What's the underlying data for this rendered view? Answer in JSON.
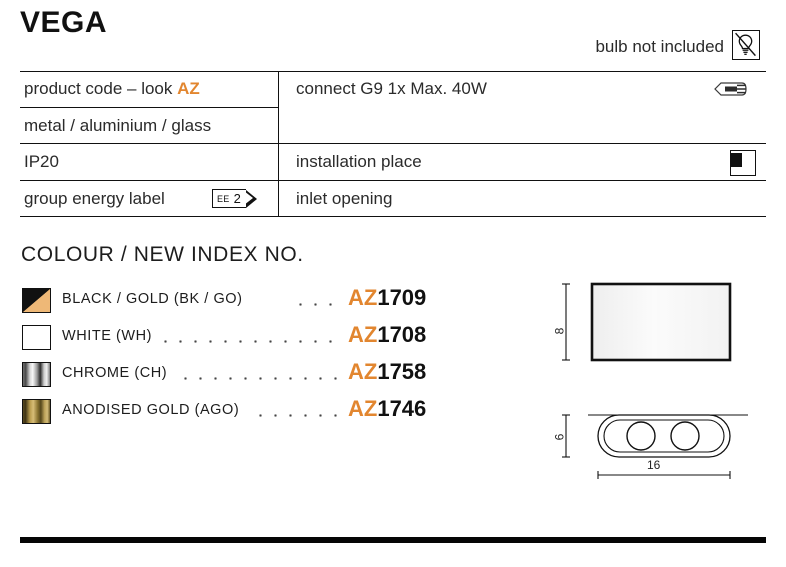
{
  "product": {
    "title": "VEGA",
    "bulb_note": "bulb not included",
    "bulb_icon": "bulb-not-included-icon"
  },
  "spec_table": {
    "left_column": [
      {
        "label": "product code – look ",
        "accent": "AZ",
        "name": "product-code"
      },
      {
        "label": "metal / aluminium / glass",
        "accent": "",
        "name": "materials"
      },
      {
        "label": "IP20",
        "accent": "",
        "name": "ip-rating"
      },
      {
        "label": "group energy label",
        "accent": "",
        "name": "energy-label"
      }
    ],
    "right_column": [
      {
        "label": "connect G9 1x Max. 40W",
        "name": "connection",
        "icon": "g9-bulb-icon"
      },
      {
        "label": "installation place",
        "name": "installation-place",
        "icon": "installation-place-icon"
      },
      {
        "label": "inlet opening",
        "name": "inlet-opening",
        "icon": ""
      }
    ],
    "energy_badge": {
      "text": "EE",
      "value": "2"
    }
  },
  "colour_section": {
    "heading": "COLOUR / NEW INDEX NO.",
    "items": [
      {
        "swatch": "black-gold",
        "name": "BLACK / GOLD (BK / GO)",
        "prefix": "AZ",
        "number": "1709"
      },
      {
        "swatch": "white",
        "name": "WHITE (WH)",
        "prefix": "AZ",
        "number": "1708"
      },
      {
        "swatch": "chrome",
        "name": "CHROME (CH)",
        "prefix": "AZ",
        "number": "1758"
      },
      {
        "swatch": "gold",
        "name": "ANODISED GOLD (AGO)",
        "prefix": "AZ",
        "number": "1746"
      }
    ]
  },
  "drawings": {
    "side_view": {
      "height": "8"
    },
    "bottom_view": {
      "height": "6",
      "width": "16"
    }
  },
  "colors": {
    "accent_orange": "#e2862f",
    "ink": "#111111",
    "text": "#2b2b2b"
  }
}
